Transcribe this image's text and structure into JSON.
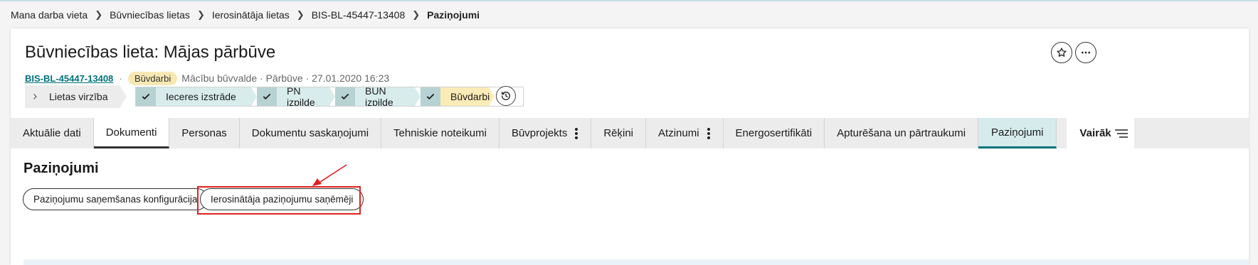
{
  "breadcrumb": {
    "items": [
      "Mana darba vieta",
      "Būvniecības lietas",
      "Ierosinātāja lietas",
      "BIS-BL-45447-13408"
    ],
    "current": "Paziņojumi"
  },
  "header": {
    "title": "Būvniecības lieta: Mājas pārbūve",
    "case_id": "BIS-BL-45447-13408",
    "status_badge": "Būvdarbi",
    "meta_text": "Mācību būvvalde · Pārbūve · 27.01.2020 16:23"
  },
  "stages": {
    "head_label": "Lietas virzība",
    "steps": [
      {
        "label": "Ieceres izstrāde",
        "state": "done"
      },
      {
        "label": "PN izpilde",
        "state": "done"
      },
      {
        "label": "BUN izpilde",
        "state": "done"
      },
      {
        "label": "Būvdarbi",
        "state": "current"
      }
    ]
  },
  "tabs": {
    "items": [
      {
        "label": "Aktuālie dati"
      },
      {
        "label": "Dokumenti"
      },
      {
        "label": "Personas"
      },
      {
        "label": "Dokumentu saskaņojumi"
      },
      {
        "label": "Tehniskie noteikumi"
      },
      {
        "label": "Būvprojekts"
      },
      {
        "label": "Rēķini"
      },
      {
        "label": "Atzinumi"
      },
      {
        "label": "Energosertifikāti"
      },
      {
        "label": "Apturēšana un pārtraukumi"
      },
      {
        "label": "Paziņojumi"
      }
    ],
    "more_label": "Vairāk"
  },
  "section": {
    "title": "Paziņojumi",
    "buttons": [
      "Paziņojumu saņemšanas konfigurācija",
      "Ierosinātāja paziņojumu saņēmēji"
    ]
  },
  "colors": {
    "accent": "#00727c",
    "highlight": "#e02020",
    "badge": "#f7e8b3"
  }
}
